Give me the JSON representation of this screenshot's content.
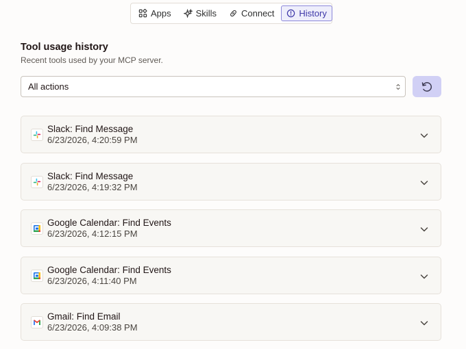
{
  "tabs": [
    {
      "label": "Apps",
      "icon": "apps-grid-icon"
    },
    {
      "label": "Skills",
      "icon": "sparkle-icon"
    },
    {
      "label": "Connect",
      "icon": "link-icon"
    },
    {
      "label": "History",
      "icon": "clock-icon",
      "active": true
    }
  ],
  "history": {
    "title": "Tool usage history",
    "subtitle": "Recent tools used by your MCP server.",
    "filter": {
      "selected": "All actions"
    },
    "refresh_icon": "refresh-icon",
    "accent_color": "#d1d0f5",
    "items": [
      {
        "app": "slack",
        "title": "Slack: Find Message",
        "time": "6/23/2026, 4:20:59 PM"
      },
      {
        "app": "slack",
        "title": "Slack: Find Message",
        "time": "6/23/2026, 4:19:32 PM"
      },
      {
        "app": "google-calendar",
        "title": "Google Calendar: Find Events",
        "time": "6/23/2026, 4:12:15 PM"
      },
      {
        "app": "google-calendar",
        "title": "Google Calendar: Find Events",
        "time": "6/23/2026, 4:11:40 PM"
      },
      {
        "app": "gmail",
        "title": "Gmail: Find Email",
        "time": "6/23/2026, 4:09:38 PM"
      }
    ]
  }
}
